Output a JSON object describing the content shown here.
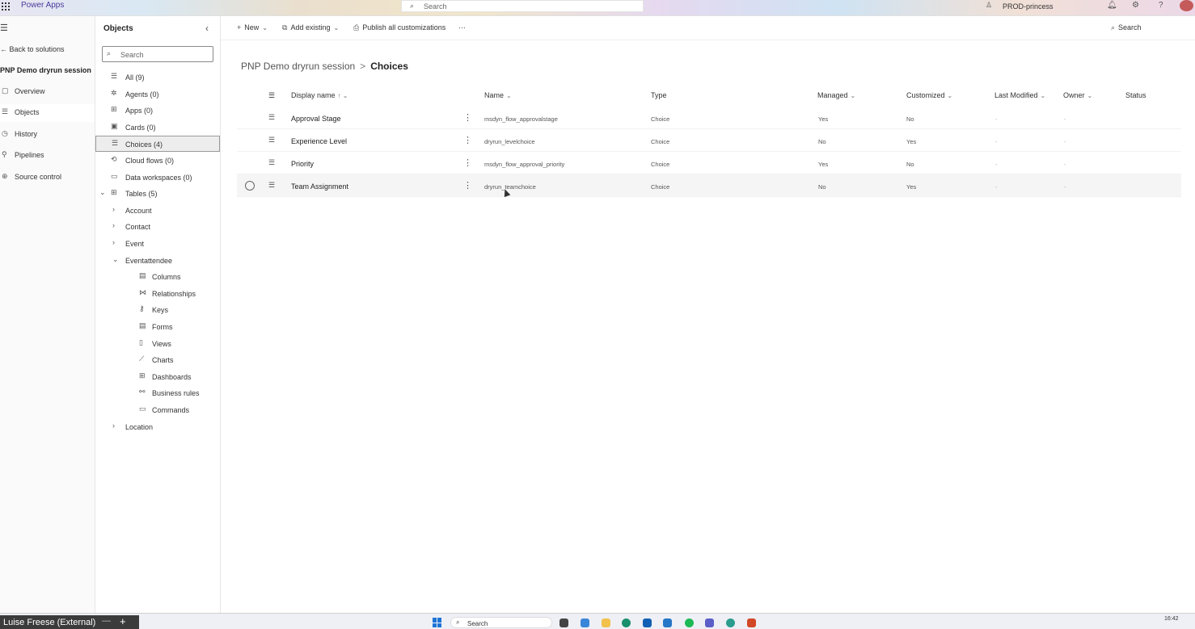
{
  "topbar": {
    "app_name": "Power Apps",
    "search_placeholder": "Search",
    "environment": "PROD-princess"
  },
  "leftnav": {
    "back_label": "Back to solutions",
    "solution_title": "PNP Demo dryrun session",
    "items": [
      {
        "label": "Overview",
        "icon": "overview-icon"
      },
      {
        "label": "Objects",
        "icon": "objects-icon",
        "active": true
      },
      {
        "label": "History",
        "icon": "history-icon"
      },
      {
        "label": "Pipelines",
        "icon": "pipelines-icon"
      },
      {
        "label": "Source control",
        "icon": "source-control-icon"
      }
    ]
  },
  "objects_panel": {
    "title": "Objects",
    "search_placeholder": "Search",
    "items": [
      {
        "label": "All  (9)"
      },
      {
        "label": "Agents  (0)"
      },
      {
        "label": "Apps  (0)"
      },
      {
        "label": "Cards  (0)"
      },
      {
        "label": "Choices  (4)",
        "selected": true
      },
      {
        "label": "Cloud flows  (0)"
      },
      {
        "label": "Data workspaces  (0)"
      },
      {
        "label": "Tables  (5)"
      },
      {
        "label": "Account"
      },
      {
        "label": "Contact"
      },
      {
        "label": "Event"
      },
      {
        "label": "Eventattendee"
      },
      {
        "label": "Columns"
      },
      {
        "label": "Relationships"
      },
      {
        "label": "Keys"
      },
      {
        "label": "Forms"
      },
      {
        "label": "Views"
      },
      {
        "label": "Charts"
      },
      {
        "label": "Dashboards"
      },
      {
        "label": "Business rules"
      },
      {
        "label": "Commands"
      },
      {
        "label": "Location"
      }
    ]
  },
  "command_bar": {
    "new_label": "New",
    "add_existing_label": "Add existing",
    "publish_label": "Publish all customizations",
    "more_label": "···",
    "search_label": "Search"
  },
  "breadcrumb": {
    "parent": "PNP Demo dryrun session",
    "separator": ">",
    "current": "Choices"
  },
  "grid": {
    "columns": {
      "display_name": "Display name",
      "name": "Name",
      "type": "Type",
      "managed": "Managed",
      "customized": "Customized",
      "last_modified": "Last Modified",
      "owner": "Owner",
      "status": "Status"
    },
    "rows": [
      {
        "display_name": "Approval Stage",
        "name": "msdyn_flow_approvalstage",
        "type": "Choice",
        "managed": "Yes",
        "customized": "No",
        "last_modified": "-",
        "owner": "-"
      },
      {
        "display_name": "Experience Level",
        "name": "dryrun_levelchoice",
        "type": "Choice",
        "managed": "No",
        "customized": "Yes",
        "last_modified": "-",
        "owner": "-"
      },
      {
        "display_name": "Priority",
        "name": "msdyn_flow_approval_priority",
        "type": "Choice",
        "managed": "Yes",
        "customized": "No",
        "last_modified": "-",
        "owner": "-"
      },
      {
        "display_name": "Team Assignment",
        "name": "dryrun_teamchoice",
        "type": "Choice",
        "managed": "No",
        "customized": "Yes",
        "last_modified": "-",
        "owner": "-"
      }
    ]
  },
  "taskbar": {
    "profile_tab": "Luise Freese (External)",
    "search_placeholder": "Search",
    "clock": "16:42"
  },
  "colors": {
    "brand": "#4a3a9b",
    "windows_blue": "#1f74d6"
  }
}
